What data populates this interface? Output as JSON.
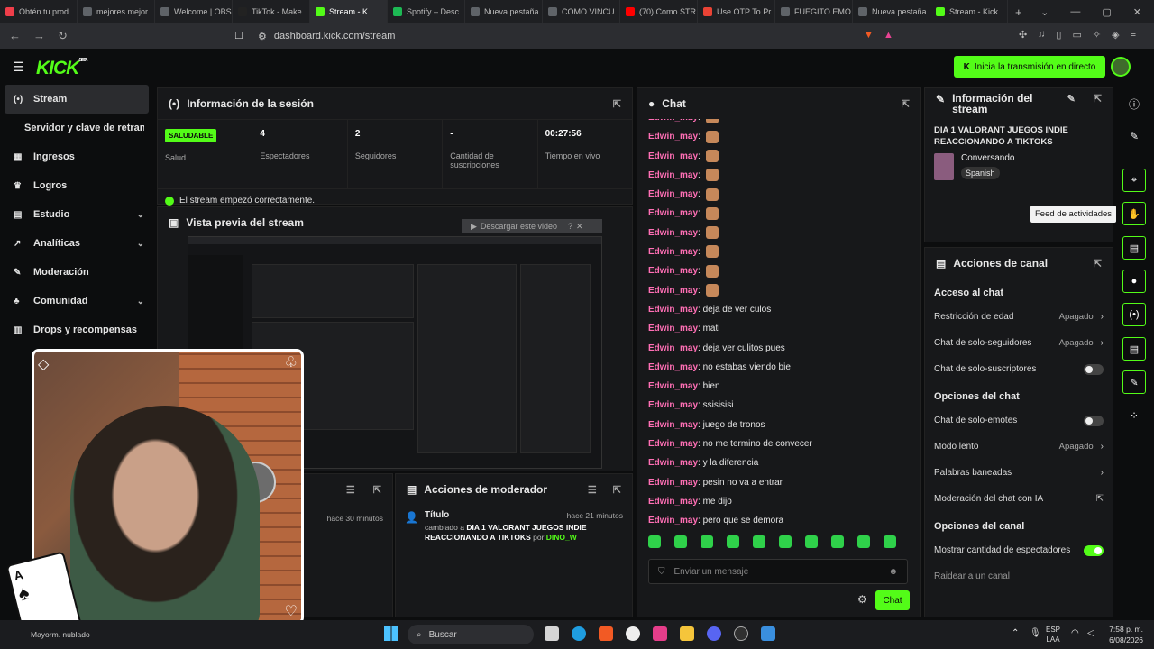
{
  "browser": {
    "tabs": [
      {
        "label": "Obtén tu prod",
        "color": "#ef3e4a"
      },
      {
        "label": "mejores mejor",
        "color": "#5f6368"
      },
      {
        "label": "Welcome | OBS",
        "color": "#5f6368"
      },
      {
        "label": "TikTok - Make",
        "color": "#222222"
      },
      {
        "label": "Stream - K",
        "color": "#53fc18",
        "active": true
      },
      {
        "label": "Spotify – Desc",
        "color": "#1db954"
      },
      {
        "label": "Nueva pestaña",
        "color": "#5f6368"
      },
      {
        "label": "COMO VINCU",
        "color": "#5f6368"
      },
      {
        "label": "(70) Como STR",
        "color": "#ff0000"
      },
      {
        "label": "Use OTP To Pr",
        "color": "#ea4335"
      },
      {
        "label": "FUEGITO EMO",
        "color": "#5f6368"
      },
      {
        "label": "Nueva pestaña",
        "color": "#5f6368"
      },
      {
        "label": "Stream - Kick",
        "color": "#53fc18"
      }
    ],
    "url": "dashboard.kick.com/stream"
  },
  "header": {
    "logo": "KICK",
    "logo_sup": "BETA",
    "go_live": "Inicia la transmisión en directo"
  },
  "sidebar": {
    "items": [
      {
        "label": "Stream",
        "icon": "broadcast-icon"
      },
      {
        "label": "Servidor y clave de retransmisión"
      },
      {
        "label": "Ingresos",
        "icon": "chart-icon"
      },
      {
        "label": "Logros",
        "icon": "trophy-icon"
      },
      {
        "label": "Estudio",
        "icon": "studio-icon",
        "chevron": true
      },
      {
        "label": "Analíticas",
        "icon": "analytics-icon",
        "chevron": true
      },
      {
        "label": "Moderación",
        "icon": "wrench-icon"
      },
      {
        "label": "Comunidad",
        "icon": "community-icon",
        "chevron": true
      },
      {
        "label": "Drops y recompensas",
        "icon": "gift-icon"
      }
    ]
  },
  "session": {
    "title": "Información de la sesión",
    "status": "SALUDABLE",
    "status_label": "Salud",
    "viewers": "4",
    "viewers_label": "Espectadores",
    "followers": "2",
    "followers_label": "Seguidores",
    "subs": "-",
    "subs_label": "Cantidad de suscripciones",
    "uptime": "00:27:56",
    "uptime_label": "Tiempo en vivo",
    "ok_message": "El stream empezó correctamente."
  },
  "preview": {
    "title": "Vista previa del stream",
    "download": "Descargar este video"
  },
  "left_feed": {
    "time": "hace 30 minutos"
  },
  "mod_actions": {
    "title": "Acciones de moderador",
    "item_title": "Título",
    "item_time": "hace 21 minutos",
    "item_prefix": "cambiado a",
    "item_text": "DIA 1 VALORANT JUEGOS INDIE REACCIONANDO A TIKTOKS",
    "item_by": "por",
    "item_user": "DINO_W"
  },
  "chat": {
    "title": "Chat",
    "messages": [
      {
        "user": "Edwin_may",
        "text": "",
        "emote": true
      },
      {
        "user": "Edwin_may",
        "text": "",
        "emote": true
      },
      {
        "user": "Edwin_may",
        "text": "",
        "emote": true
      },
      {
        "user": "Edwin_may",
        "text": "",
        "emote": true
      },
      {
        "user": "Edwin_may",
        "text": "",
        "emote": true
      },
      {
        "user": "Edwin_may",
        "text": "",
        "emote": true
      },
      {
        "user": "Edwin_may",
        "text": "",
        "emote": true
      },
      {
        "user": "Edwin_may",
        "text": "",
        "emote": true
      },
      {
        "user": "Edwin_may",
        "text": "",
        "emote": true
      },
      {
        "user": "Edwin_may",
        "text": "",
        "emote": true
      },
      {
        "user": "Edwin_may",
        "text": "deja de ver culos"
      },
      {
        "user": "Edwin_may",
        "text": "mati"
      },
      {
        "user": "Edwin_may",
        "text": "deja ver culitos pues"
      },
      {
        "user": "Edwin_may",
        "text": "no estabas viendo bie"
      },
      {
        "user": "Edwin_may",
        "text": "bien"
      },
      {
        "user": "Edwin_may",
        "text": "ssisisisi"
      },
      {
        "user": "Edwin_may",
        "text": "juego de tronos"
      },
      {
        "user": "Edwin_may",
        "text": "no me termino de convecer"
      },
      {
        "user": "Edwin_may",
        "text": "y la diferencia"
      },
      {
        "user": "Edwin_may",
        "text": "pesin no va a entrar"
      },
      {
        "user": "Edwin_may",
        "text": "me dijo"
      },
      {
        "user": "Edwin_may",
        "text": "pero que se demora"
      }
    ],
    "input_placeholder": "Enviar un mensaje",
    "send": "Chat"
  },
  "stream_info": {
    "title": "Información del stream",
    "stream_title": "DIA 1 VALORANT JUEGOS INDIE REACCIONANDO A TIKTOKS",
    "category": "Conversando",
    "language": "Spanish"
  },
  "channel_actions": {
    "title": "Acciones de canal",
    "chat_access": "Acceso al chat",
    "age_restriction": "Restricción de edad",
    "age_restriction_val": "Apagado",
    "followers_only": "Chat de solo-seguidores",
    "followers_only_val": "Apagado",
    "subs_only": "Chat de solo-suscriptores",
    "chat_options": "Opciones del chat",
    "emotes_only": "Chat de solo-emotes",
    "slow_mode": "Modo lento",
    "slow_mode_val": "Apagado",
    "banned_words": "Palabras baneadas",
    "ai_moderation": "Moderación del chat con IA",
    "channel_options": "Opciones del canal",
    "show_viewers": "Mostrar cantidad de espectadores",
    "raid": "Raidear a un canal"
  },
  "tooltip": "Feed de actividades",
  "taskbar": {
    "search": "Buscar",
    "lang_top": "ESP",
    "lang_bottom": "LAA",
    "time": "7:58 p. m.",
    "date": "6/08/2026",
    "weather": "Mayorm. nublado"
  }
}
